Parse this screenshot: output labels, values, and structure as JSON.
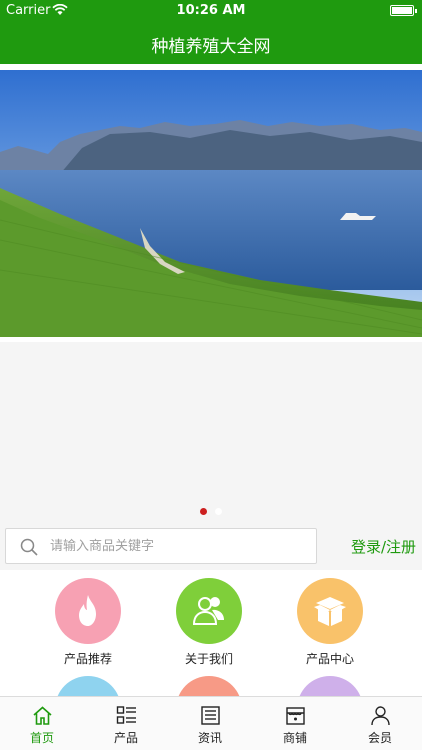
{
  "status_bar": {
    "carrier": "Carrier",
    "time": "10:26 AM"
  },
  "nav": {
    "title": "种植养殖大全网"
  },
  "carousel": {
    "slide_count": 2,
    "active_index": 0
  },
  "search": {
    "placeholder": "请输入商品关键字",
    "value": ""
  },
  "login_link": "登录/注册",
  "menu": {
    "items": [
      {
        "label": "产品推荐",
        "color": "#f7a1b3",
        "icon": "flame-icon"
      },
      {
        "label": "关于我们",
        "color": "#7fcf3a",
        "icon": "users-icon"
      },
      {
        "label": "产品中心",
        "color": "#f9c26a",
        "icon": "box-icon"
      },
      {
        "label": "",
        "color": "#8fd3ef",
        "icon": "circle-icon"
      },
      {
        "label": "",
        "color": "#f79a86",
        "icon": "circle-icon"
      },
      {
        "label": "",
        "color": "#cfb0ea",
        "icon": "circle-icon"
      }
    ]
  },
  "tabs": [
    {
      "label": "首页",
      "icon": "home-icon",
      "active": true
    },
    {
      "label": "产品",
      "icon": "list-icon",
      "active": false
    },
    {
      "label": "资讯",
      "icon": "news-icon",
      "active": false
    },
    {
      "label": "商铺",
      "icon": "store-icon",
      "active": false
    },
    {
      "label": "会员",
      "icon": "user-icon",
      "active": false
    }
  ],
  "colors": {
    "brand_green": "#1f9a0f",
    "active_dot": "#cc1f1f",
    "tab_active": "#1f9a0f"
  }
}
